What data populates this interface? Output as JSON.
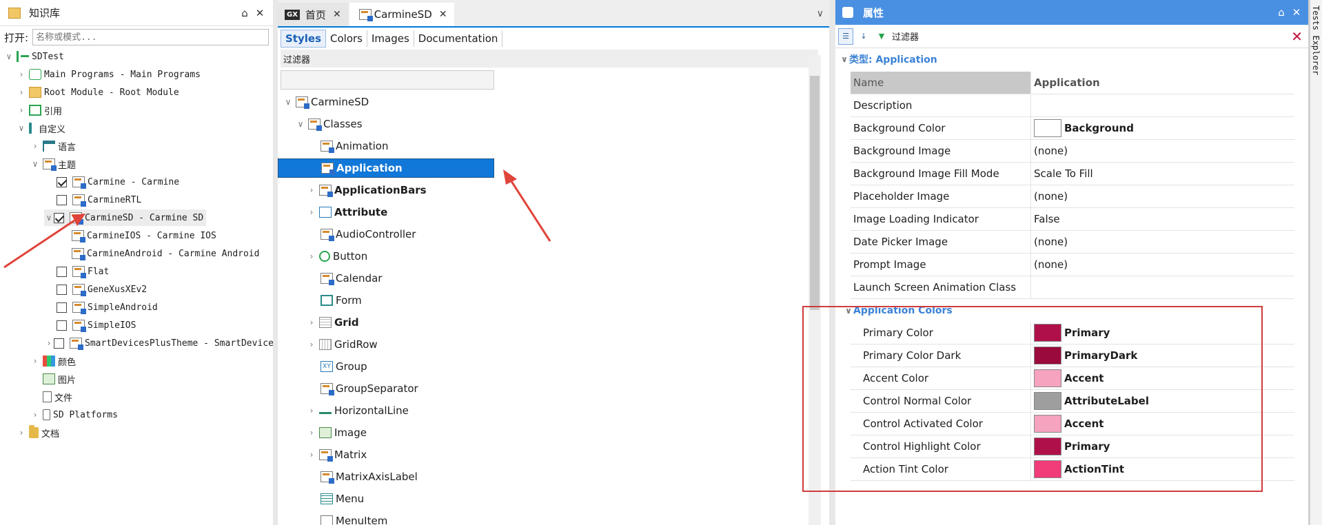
{
  "kb": {
    "title": "知识库",
    "pin": "⌂",
    "close": "✕",
    "open_label": "打开:",
    "open_placeholder": "名称或模式...",
    "items": [
      {
        "label": "SDTest"
      },
      {
        "label": "Main Programs - Main Programs"
      },
      {
        "label": "Root Module - Root Module"
      },
      {
        "label": "引用"
      },
      {
        "label": "自定义"
      },
      {
        "label": "语言"
      },
      {
        "label": "主题"
      },
      {
        "label": "Carmine - Carmine"
      },
      {
        "label": "CarmineRTL"
      },
      {
        "label": "CarmineSD - Carmine SD"
      },
      {
        "label": "CarmineIOS - Carmine IOS"
      },
      {
        "label": "CarmineAndroid - Carmine Android"
      },
      {
        "label": "Flat"
      },
      {
        "label": "GeneXusXEv2"
      },
      {
        "label": "SimpleAndroid"
      },
      {
        "label": "SimpleIOS"
      },
      {
        "label": "SmartDevicesPlusTheme - SmartDevicesP"
      },
      {
        "label": "颜色"
      },
      {
        "label": "图片"
      },
      {
        "label": "文件"
      },
      {
        "label": "SD Platforms"
      },
      {
        "label": "文档"
      }
    ]
  },
  "editor": {
    "gx_badge": "GX",
    "tabs": [
      {
        "label": "首页"
      },
      {
        "label": "CarmineSD"
      }
    ],
    "close": "✕",
    "chevron": "∨",
    "subtabs": [
      {
        "label": "Styles"
      },
      {
        "label": "Colors"
      },
      {
        "label": "Images"
      },
      {
        "label": "Documentation"
      }
    ],
    "filter_label": "过滤器",
    "tree": [
      {
        "label": "CarmineSD"
      },
      {
        "label": "Classes"
      },
      {
        "label": "Animation"
      },
      {
        "label": "Application"
      },
      {
        "label": "ApplicationBars"
      },
      {
        "label": "Attribute"
      },
      {
        "label": "AudioController"
      },
      {
        "label": "Button"
      },
      {
        "label": "Calendar"
      },
      {
        "label": "Form"
      },
      {
        "label": "Grid"
      },
      {
        "label": "GridRow"
      },
      {
        "label": "Group"
      },
      {
        "label": "GroupSeparator"
      },
      {
        "label": "HorizontalLine"
      },
      {
        "label": "Image"
      },
      {
        "label": "Matrix"
      },
      {
        "label": "MatrixAxisLabel"
      },
      {
        "label": "Menu"
      },
      {
        "label": "MenuItem"
      }
    ]
  },
  "props": {
    "title": "属性",
    "pin": "⌂",
    "close": "✕",
    "filter_label": "过滤器",
    "clear": "✕",
    "category": "类型: Application",
    "header": {
      "name": "Name",
      "value": "Application"
    },
    "rows": [
      {
        "name": "Description",
        "value": ""
      },
      {
        "name": "Background Color",
        "value": "Background",
        "color": "#ffffff"
      },
      {
        "name": "Background Image",
        "value": "(none)"
      },
      {
        "name": "Background Image Fill Mode",
        "value": "Scale To Fill"
      },
      {
        "name": "Placeholder Image",
        "value": "(none)"
      },
      {
        "name": "Image Loading Indicator",
        "value": "False"
      },
      {
        "name": "Date Picker Image",
        "value": "(none)"
      },
      {
        "name": "Prompt Image",
        "value": "(none)"
      },
      {
        "name": "Launch Screen Animation Class",
        "value": ""
      }
    ],
    "app_colors_label": "Application Colors",
    "app_colors": [
      {
        "name": "Primary Color",
        "value": "Primary",
        "color": "#b0104a"
      },
      {
        "name": "Primary Color Dark",
        "value": "PrimaryDark",
        "color": "#9a0a3c"
      },
      {
        "name": "Accent Color",
        "value": "Accent",
        "color": "#f5a3bf"
      },
      {
        "name": "Control Normal Color",
        "value": "AttributeLabel",
        "color": "#9e9e9e"
      },
      {
        "name": "Control Activated Color",
        "value": "Accent",
        "color": "#f5a3bf"
      },
      {
        "name": "Control Highlight Color",
        "value": "Primary",
        "color": "#b0104a"
      },
      {
        "name": "Action Tint Color",
        "value": "ActionTint",
        "color": "#f03c78"
      }
    ]
  },
  "tests_explorer": "Tests Explorer",
  "colors": {
    "accent": "#1177d9",
    "annotation": "#d03a3a",
    "props_header": "#4a90e2"
  }
}
